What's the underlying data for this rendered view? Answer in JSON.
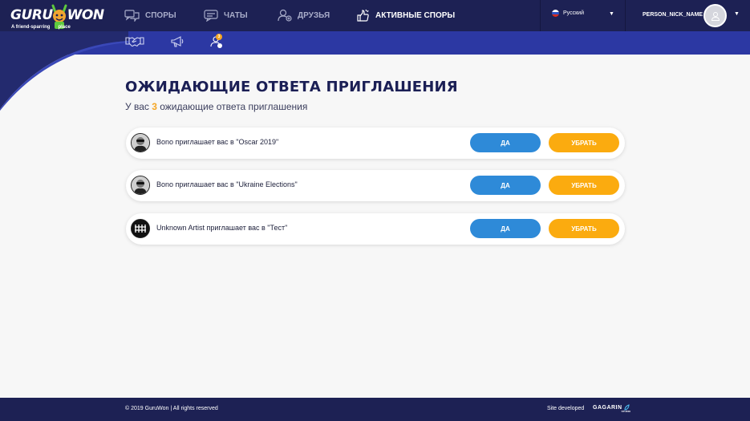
{
  "brand": {
    "logo_left": "GURU",
    "logo_right": "WON",
    "tagline_left": "A friend-sparring",
    "tagline_right": "place"
  },
  "nav": {
    "items": [
      {
        "label": "Споры",
        "icon": "debates-icon"
      },
      {
        "label": "Чаты",
        "icon": "chat-icon"
      },
      {
        "label": "Друзья",
        "icon": "friends-icon"
      },
      {
        "label": "Активные споры",
        "icon": "active-debates-icon"
      }
    ],
    "active_index": 3
  },
  "language": {
    "label": "Русский",
    "flag": "russia-flag-icon"
  },
  "user": {
    "nick": "PERSON_NICK_NAME"
  },
  "subnav": {
    "icons": [
      "handshake-icon",
      "megaphone-icon",
      "invitations-icon"
    ],
    "badge_count": "3"
  },
  "main": {
    "title": "Ожидающие ответа приглашения",
    "summary_prefix": "У вас ",
    "summary_count": "3",
    "summary_suffix": " ожидающие ответа приглашения",
    "invitations": [
      {
        "text": "Bono приглашает вас в \"Oscar 2019\"",
        "avatar": "bono-avatar",
        "accept_label": "Да",
        "remove_label": "Убрать"
      },
      {
        "text": "Bono приглашает вас в \"Ukraine Elections\"",
        "avatar": "bono-avatar",
        "accept_label": "Да",
        "remove_label": "Убрать"
      },
      {
        "text": "Unknown Artist приглашает вас в \"Тест\"",
        "avatar": "unknown-artist-avatar",
        "accept_label": "Да",
        "remove_label": "Убрать"
      }
    ]
  },
  "footer": {
    "copyright": "© 2019 GuruWon  |  All rights reserved",
    "developed": "Site developed",
    "studio": "GAGARIN",
    "studio_sub": "STUDIO"
  },
  "colors": {
    "header": "#1d2154",
    "subheader": "#2c38a3",
    "accept": "#2e8ad8",
    "remove": "#fbab0f",
    "accent": "#f5a623"
  }
}
